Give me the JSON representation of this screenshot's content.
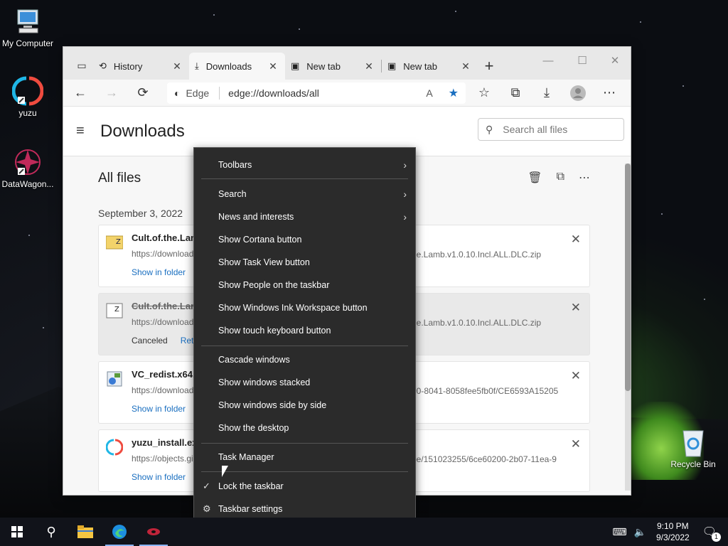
{
  "desktop": {
    "icons": [
      {
        "label": "My Computer"
      },
      {
        "label": "yuzu"
      },
      {
        "label": "DataWagon..."
      },
      {
        "label": "Recycle Bin"
      }
    ]
  },
  "browser": {
    "tabs": [
      {
        "label": "History",
        "icon": "history-icon"
      },
      {
        "label": "Downloads",
        "icon": "download-icon"
      },
      {
        "label": "New tab",
        "icon": "tab-icon"
      },
      {
        "label": "New tab",
        "icon": "tab-icon"
      }
    ],
    "address": {
      "site_label": "Edge",
      "url": "edge://downloads/all"
    }
  },
  "downloads_page": {
    "title": "Downloads",
    "search_placeholder": "Search all files",
    "section_title": "All files",
    "date_group": "September 3, 2022",
    "items": [
      {
        "name": "Cult.of.the.Lam",
        "url_left": "https://download",
        "url_right": "he.Lamb.v1.0.10.Incl.ALL.DLC.zip",
        "action": "Show in folder"
      },
      {
        "name": "Cult.of.the.Lam",
        "url_left": "https://download",
        "url_right": "he.Lamb.v1.0.10.Incl.ALL.DLC.zip",
        "status": "Canceled",
        "retry": "Retry"
      },
      {
        "name": "VC_redist.x64.e",
        "url_left": "https://download",
        "url_right": "90-8041-8058fee5fb0f/CE6593A15205",
        "action": "Show in folder"
      },
      {
        "name": "yuzu_install.exe",
        "url_left": "https://objects.gi",
        "url_right": "be/151023255/6ce60200-2b07-11ea-9",
        "action": "Show in folder"
      }
    ]
  },
  "context_menu": {
    "items": [
      {
        "label": "Toolbars",
        "submenu": true
      },
      {
        "label": "Search",
        "submenu": true
      },
      {
        "label": "News and interests",
        "submenu": true
      },
      {
        "label": "Show Cortana button"
      },
      {
        "label": "Show Task View button"
      },
      {
        "label": "Show People on the taskbar"
      },
      {
        "label": "Show Windows Ink Workspace button"
      },
      {
        "label": "Show touch keyboard button"
      },
      {
        "label": "Cascade windows"
      },
      {
        "label": "Show windows stacked"
      },
      {
        "label": "Show windows side by side"
      },
      {
        "label": "Show the desktop"
      },
      {
        "label": "Task Manager"
      },
      {
        "label": "Lock the taskbar",
        "checked": true
      },
      {
        "label": "Taskbar settings",
        "icon": "gear-icon"
      }
    ]
  },
  "taskbar": {
    "time": "9:10 PM",
    "date": "9/3/2022",
    "notification_count": "1"
  }
}
